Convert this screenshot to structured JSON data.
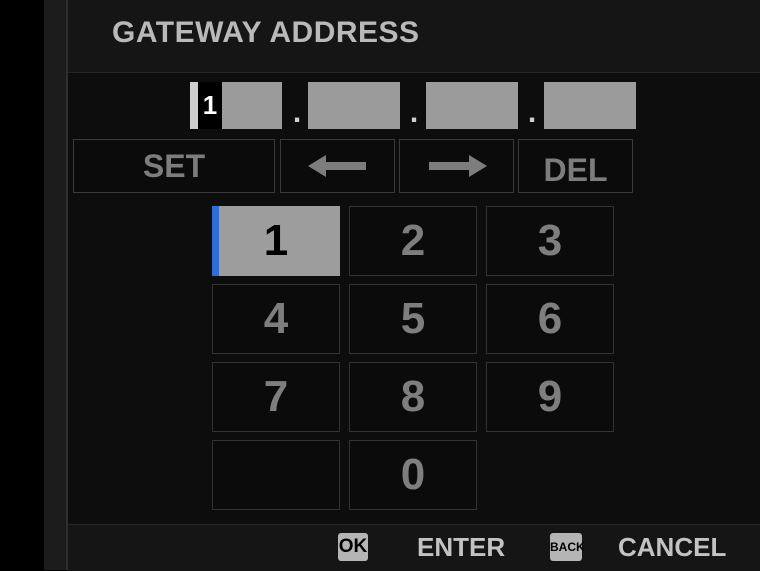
{
  "screen": {
    "title": "GATEWAY ADDRESS"
  },
  "address": {
    "octets": [
      "1",
      "",
      "",
      ""
    ],
    "separator": "."
  },
  "controls": {
    "set_label": "SET",
    "left_icon": "arrow-left-icon",
    "right_icon": "arrow-right-icon",
    "del_label": "DEL"
  },
  "keypad": {
    "keys": [
      "1",
      "2",
      "3",
      "4",
      "5",
      "6",
      "7",
      "8",
      "9",
      "",
      "0"
    ],
    "selected": "1"
  },
  "footer": {
    "ok_badge": "OK",
    "enter_label": "ENTER",
    "back_badge": "BACK",
    "cancel_label": "CANCEL"
  },
  "colors": {
    "background": "#000000",
    "selected_key": "#9d9d9d",
    "focus_accent": "#2d6fd3",
    "text_dim": "#7e7e7e"
  }
}
